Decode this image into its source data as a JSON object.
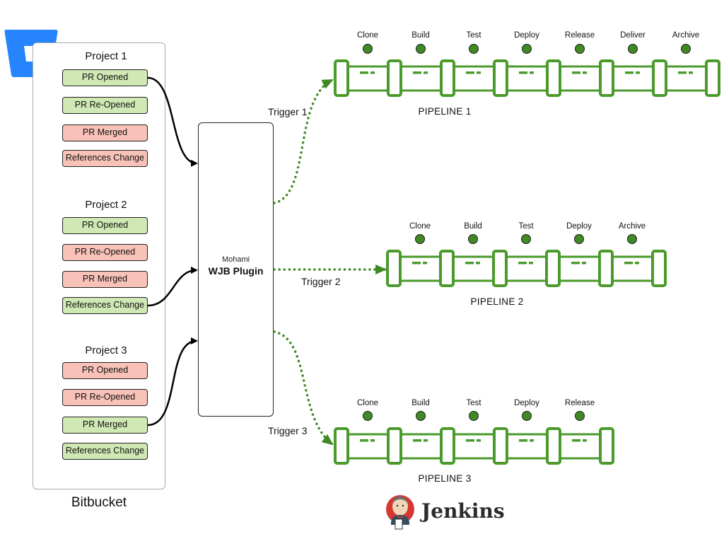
{
  "bitbucket": {
    "label": "Bitbucket",
    "logo_icon": "bitbucket-logo-icon",
    "brand_color": "#2684ff",
    "projects": [
      {
        "title": "Project 1",
        "events": [
          {
            "label": "PR Opened",
            "status": "enabled"
          },
          {
            "label": "PR Re-Opened",
            "status": "enabled"
          },
          {
            "label": "PR Merged",
            "status": "disabled"
          },
          {
            "label": "References Change",
            "status": "disabled"
          }
        ],
        "connected_event": "PR Opened"
      },
      {
        "title": "Project 2",
        "events": [
          {
            "label": "PR Opened",
            "status": "enabled"
          },
          {
            "label": "PR Re-Opened",
            "status": "disabled"
          },
          {
            "label": "PR Merged",
            "status": "disabled"
          },
          {
            "label": "References Change",
            "status": "enabled"
          }
        ],
        "connected_event": "References Change"
      },
      {
        "title": "Project 3",
        "events": [
          {
            "label": "PR Opened",
            "status": "disabled"
          },
          {
            "label": "PR Re-Opened",
            "status": "disabled"
          },
          {
            "label": "PR Merged",
            "status": "enabled"
          },
          {
            "label": "References Change",
            "status": "enabled"
          }
        ],
        "connected_event": "PR Merged"
      }
    ]
  },
  "plugin": {
    "vendor": "Mohami",
    "name": "WJB Plugin"
  },
  "triggers": [
    "Trigger 1",
    "Trigger 2",
    "Trigger 3"
  ],
  "pipelines": [
    {
      "name": "PIPELINE 1",
      "stages": [
        "Clone",
        "Build",
        "Test",
        "Deploy",
        "Release",
        "Deliver",
        "Archive"
      ]
    },
    {
      "name": "PIPELINE 2",
      "stages": [
        "Clone",
        "Build",
        "Test",
        "Deploy",
        "Archive"
      ]
    },
    {
      "name": "PIPELINE 3",
      "stages": [
        "Clone",
        "Build",
        "Test",
        "Deploy",
        "Release"
      ]
    }
  ],
  "jenkins": {
    "label": "Jenkins",
    "logo_icon": "jenkins-butler-icon"
  },
  "colors": {
    "enabled_event": "#cfe8b4",
    "disabled_event": "#f9c2b8",
    "pipeline_green": "#4a9a2c",
    "stage_dot": "#3f8a24"
  }
}
